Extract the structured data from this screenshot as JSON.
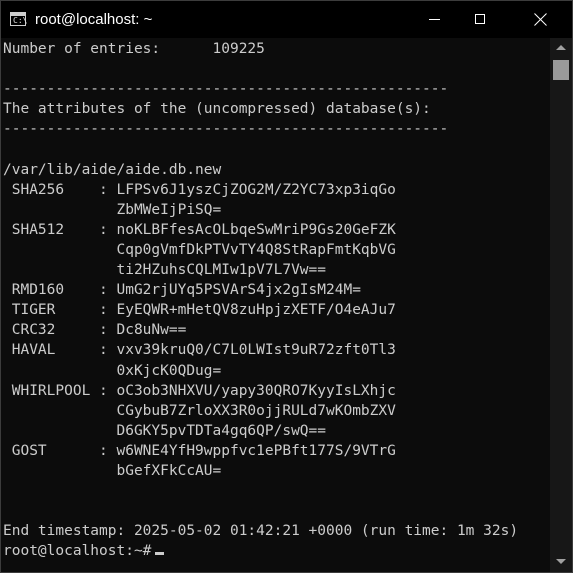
{
  "window": {
    "title": "root@localhost: ~",
    "icon": "terminal-icon",
    "app_icon_glyph": "C:\\"
  },
  "colors": {
    "background": "#0c0c0c",
    "text": "#cccccc",
    "titlebar": "#000000"
  },
  "terminal": {
    "lines": [
      "Number of entries:      109225",
      "",
      "---------------------------------------------------",
      "The attributes of the (uncompressed) database(s):",
      "---------------------------------------------------",
      "",
      "/var/lib/aide/aide.db.new",
      " SHA256    : LFPSv6J1yszCjZOG2M/Z2YC73xp3iqGo",
      "             ZbMWeIjPiSQ=",
      " SHA512    : noKLBFfesAcOLbqeSwMriP9Gs20GeFZK",
      "             Cqp0gVmfDkPTVvTY4Q8StRapFmtKqbVG",
      "             ti2HZuhsCQLMIw1pV7L7Vw==",
      " RMD160    : UmG2rjUYq5PSVArS4jx2gIsM24M=",
      " TIGER     : EyEQWR+mHetQV8zuHpjzXETF/O4eAJu7",
      " CRC32     : Dc8uNw==",
      " HAVAL     : vxv39kruQ0/C7L0LWIst9uR72zft0Tl3",
      "             0xKjcK0QDug=",
      " WHIRLPOOL : oC3ob3NHXVU/yapy30QRO7KyyIsLXhjc",
      "             CGybuB7ZrloXX3R0ojjRULd7wKOmbZXV",
      "             D6GKY5pvTDTa4gq6QP/swQ==",
      " GOST      : w6WNE4YfH9wppfvc1ePBft177S/9VTrG",
      "             bGefXFkCcAU=",
      "",
      "",
      "End timestamp: 2025-05-02 01:42:21 +0000 (run time: 1m 32s)"
    ],
    "prompt": "root@localhost:~#"
  }
}
